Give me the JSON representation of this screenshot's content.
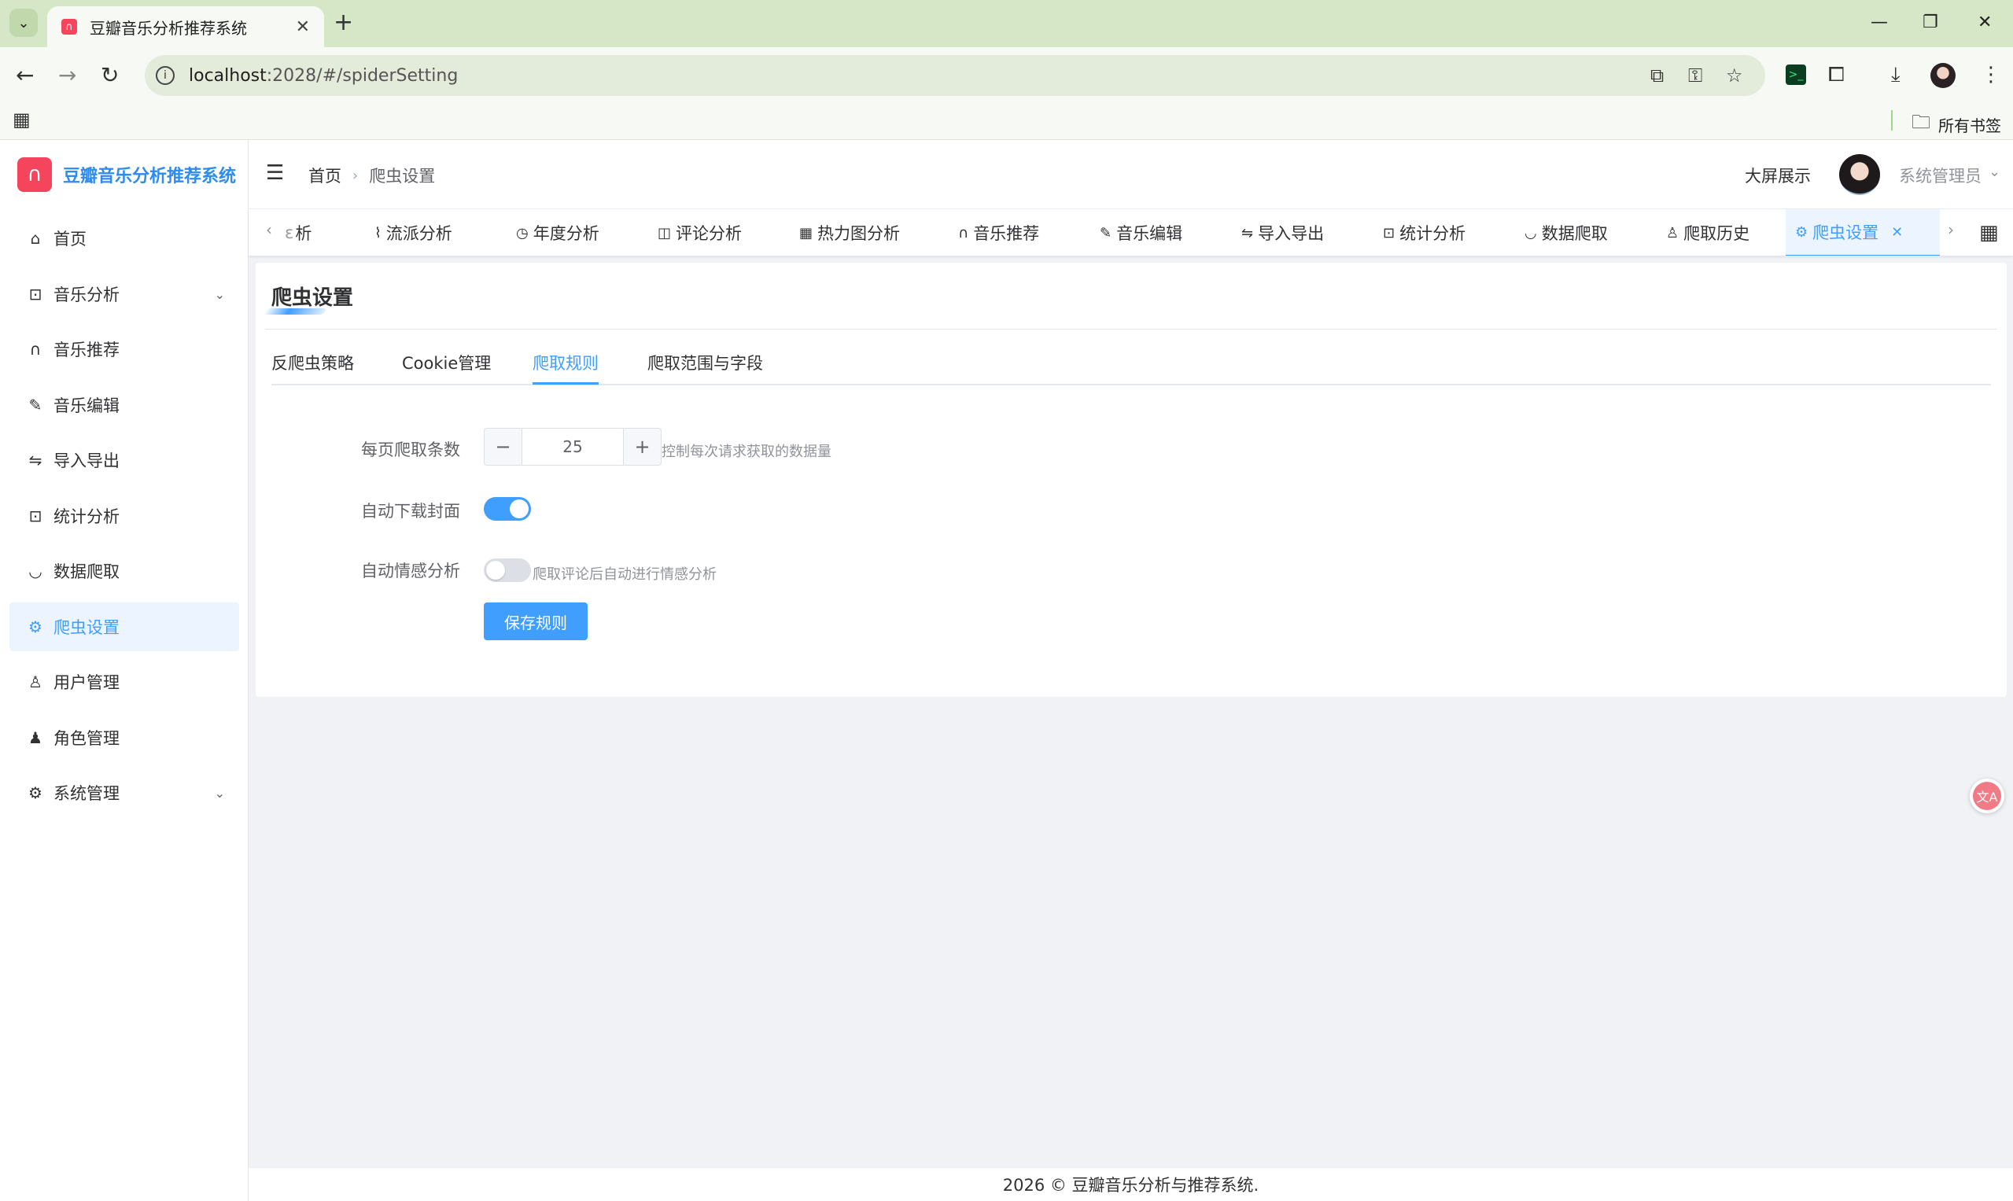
{
  "browser": {
    "tab_title": "豆瓣音乐分析推荐系统",
    "url_host": "localhost",
    "url_rest": ":2028/#/spiderSetting",
    "all_bookmarks": "所有书签"
  },
  "app": {
    "logo_text": "豆瓣音乐分析推荐系统",
    "sidebar": {
      "items": [
        {
          "label": "首页",
          "icon": "home-icon"
        },
        {
          "label": "音乐分析",
          "icon": "chart-board-icon",
          "expandable": true
        },
        {
          "label": "音乐推荐",
          "icon": "headphones-icon"
        },
        {
          "label": "音乐编辑",
          "icon": "pen-icon"
        },
        {
          "label": "导入导出",
          "icon": "switch-arrows-icon"
        },
        {
          "label": "统计分析",
          "icon": "chart-board-icon"
        },
        {
          "label": "数据爬取",
          "icon": "bowl-icon"
        },
        {
          "label": "爬虫设置",
          "icon": "gear-icon",
          "active": true
        },
        {
          "label": "用户管理",
          "icon": "user-icon"
        },
        {
          "label": "角色管理",
          "icon": "user-filled-icon"
        },
        {
          "label": "系统管理",
          "icon": "gear-icon",
          "expandable": true
        }
      ]
    },
    "header": {
      "breadcrumb_home": "首页",
      "breadcrumb_current": "爬虫设置",
      "big_screen": "大屏展示",
      "username": "系统管理员"
    },
    "tags": [
      {
        "label": "析",
        "icon": ""
      },
      {
        "label": "流派分析",
        "icon": "link-icon"
      },
      {
        "label": "年度分析",
        "icon": "clock-icon"
      },
      {
        "label": "评论分析",
        "icon": "book-icon"
      },
      {
        "label": "热力图分析",
        "icon": "grid-icon"
      },
      {
        "label": "音乐推荐",
        "icon": "headphones-icon"
      },
      {
        "label": "音乐编辑",
        "icon": "pen-icon"
      },
      {
        "label": "导入导出",
        "icon": "switch-arrows-icon"
      },
      {
        "label": "统计分析",
        "icon": "chart-board-icon"
      },
      {
        "label": "数据爬取",
        "icon": "bowl-icon"
      },
      {
        "label": "爬取历史",
        "icon": "user-icon"
      },
      {
        "label": "爬虫设置",
        "icon": "gear-icon",
        "active": true
      }
    ],
    "card": {
      "title": "爬虫设置",
      "subtabs": [
        "反爬虫策略",
        "Cookie管理",
        "爬取规则",
        "爬取范围与字段"
      ],
      "active_subtab": "爬取规则",
      "form": {
        "per_page_label": "每页爬取条数",
        "per_page_value": "25",
        "per_page_hint": "控制每次请求获取的数据量",
        "auto_cover_label": "自动下载封面",
        "auto_cover_on": true,
        "auto_sentiment_label": "自动情感分析",
        "auto_sentiment_on": false,
        "auto_sentiment_hint": "爬取评论后自动进行情感分析",
        "save_button": "保存规则"
      }
    },
    "footer": "2026 © 豆瓣音乐分析与推荐系统."
  },
  "colors": {
    "primary": "#409eff",
    "logo_red": "#f5455c",
    "browser_frame": "#d6e7c8"
  }
}
